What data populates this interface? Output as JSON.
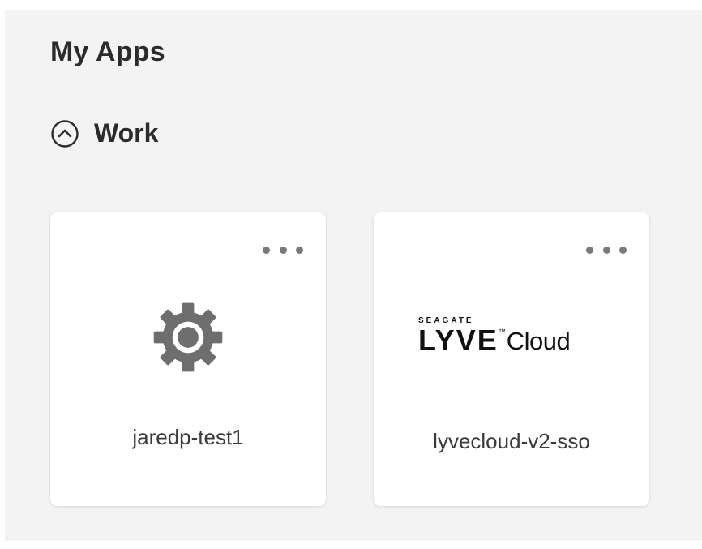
{
  "page": {
    "title": "My Apps"
  },
  "section": {
    "title": "Work",
    "icon": "chevron-up-circle-icon",
    "expanded": true
  },
  "apps": [
    {
      "name": "jaredp-test1",
      "icon": "gear-icon",
      "more_icon": "more-horizontal-icon"
    },
    {
      "name": "lyvecloud-v2-sso",
      "icon": "lyve-cloud-logo",
      "logo": {
        "brand_top": "SEAGATE",
        "word": "LYVE",
        "tm": "™",
        "suffix": "Cloud"
      },
      "more_icon": "more-horizontal-icon"
    }
  ],
  "colors": {
    "panel_background": "#f3f3f3",
    "card_background": "#ffffff",
    "text_primary": "#2b2b2b",
    "icon_gray": "#6e6e6e"
  }
}
